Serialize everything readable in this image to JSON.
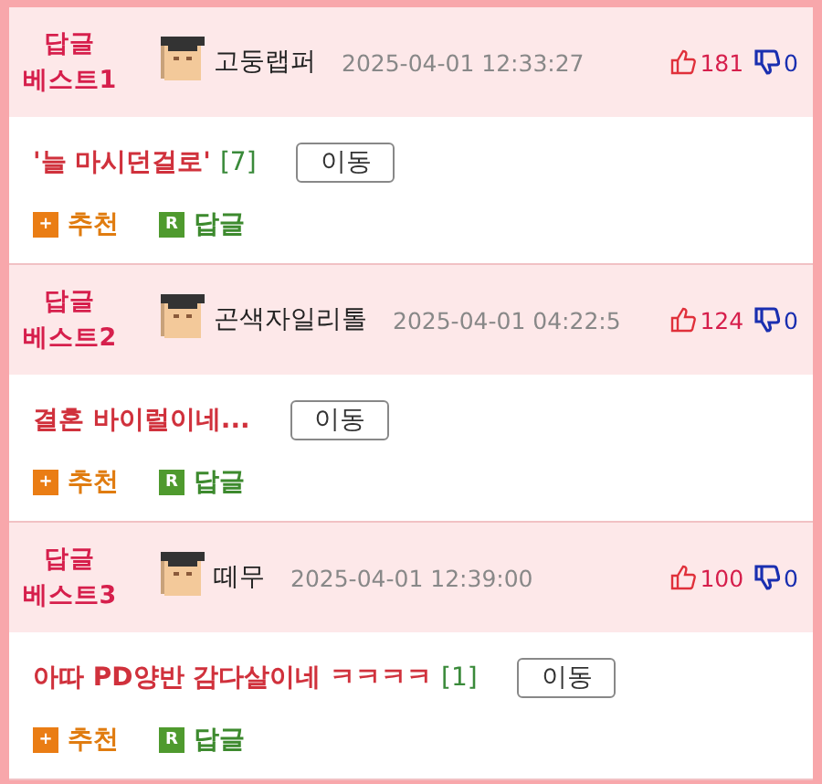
{
  "comments": [
    {
      "rank_label": "답글",
      "rank": "베스트1",
      "author": "고둥랩퍼",
      "date": "2025-04-01 12:33:27",
      "likes": "181",
      "dislikes": "0",
      "title": "'늘 마시던걸로'",
      "count": "[7]",
      "move_button": "이동",
      "recommend": {
        "icon": "+",
        "label": "추천"
      },
      "reply": {
        "icon": "R",
        "label": "답글"
      }
    },
    {
      "rank_label": "답글",
      "rank": "베스트2",
      "author": "곤색자일리톨",
      "date": "2025-04-01 04:22:5",
      "likes": "124",
      "dislikes": "0",
      "title": "결혼 바이럴이네...",
      "move_button": "이동",
      "recommend": {
        "icon": "+",
        "label": "추천"
      },
      "reply": {
        "icon": "R",
        "label": "답글"
      }
    },
    {
      "rank_label": "답글",
      "rank": "베스트3",
      "author": "떼무",
      "date": "2025-04-01 12:39:00",
      "likes": "100",
      "dislikes": "0",
      "title": "아따 PD양반 감다살이네 ㅋㅋㅋㅋ",
      "count": "[1]",
      "move_button": "이동",
      "recommend": {
        "icon": "+",
        "label": "추천"
      },
      "reply": {
        "icon": "R",
        "label": "답글"
      }
    }
  ]
}
